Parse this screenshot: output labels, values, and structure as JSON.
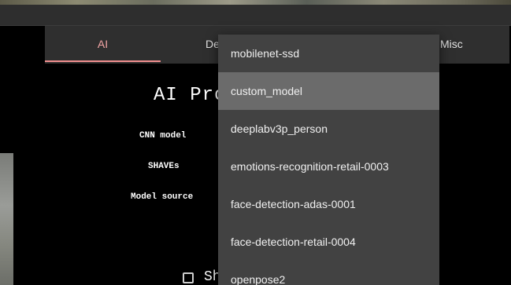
{
  "tabs": [
    {
      "label": "AI"
    },
    {
      "label": "De"
    },
    {
      "label": "Misc"
    }
  ],
  "main": {
    "heading": "AI Pro",
    "labels": {
      "cnn_model": "CNN model",
      "shaves": "SHAVEs",
      "model_source": "Model source"
    },
    "checkbox_label": "Sh",
    "checkbox_checked": false
  },
  "dropdown": {
    "selected": "custom_model",
    "options": [
      "mobilenet-ssd",
      "custom_model",
      "deeplabv3p_person",
      "emotions-recognition-retail-0003",
      "face-detection-adas-0001",
      "face-detection-retail-0004",
      "openpose2"
    ]
  },
  "colors": {
    "active_tab": "#f3a5a5",
    "menu_bg": "#424242",
    "menu_selected": "#6b6b6b"
  }
}
